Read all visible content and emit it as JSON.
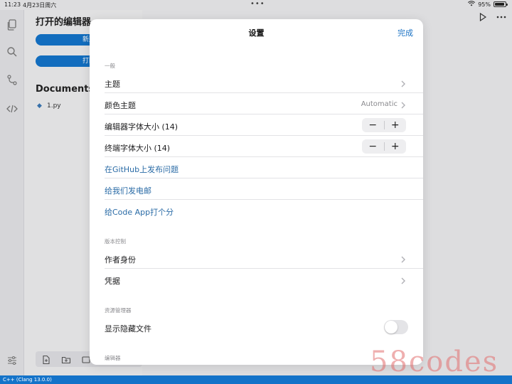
{
  "status_bar": {
    "time": "11:23",
    "date": "4月23日周六",
    "battery": "95%",
    "battery_level": 0.95
  },
  "explorer": {
    "title": "打开的编辑器",
    "new_button": "新建",
    "open_button": "打開",
    "documents_title": "Documents",
    "files": [
      {
        "name": "1.py"
      }
    ]
  },
  "icons": {
    "activity": [
      "files-icon",
      "search-icon",
      "source-control-icon",
      "code-icon"
    ],
    "settings": "sliders-icon"
  },
  "footer": {
    "language": "C++ (Clang 13.0.0)"
  },
  "settings": {
    "title": "设置",
    "done": "完成",
    "sections": {
      "general": "一般",
      "version_control": "版本控制",
      "explorer": "资源管理器",
      "editor": "编辑器"
    },
    "rows": {
      "theme": "主题",
      "color_theme": "颜色主题",
      "color_theme_value": "Automatic",
      "editor_font_size": "编辑器字体大小 (14)",
      "terminal_font_size": "终端字体大小 (14)",
      "github_issue": "在GitHub上发布问题",
      "email_us": "给我们发电邮",
      "rate_app": "给Code App打个分",
      "author_identity": "作者身份",
      "credentials": "凭据",
      "show_hidden_files": "显示隐藏文件"
    },
    "show_hidden_files_enabled": false
  },
  "colors": {
    "accent": "#1473c9",
    "link": "#2a6ba6"
  },
  "watermark": "58codes"
}
